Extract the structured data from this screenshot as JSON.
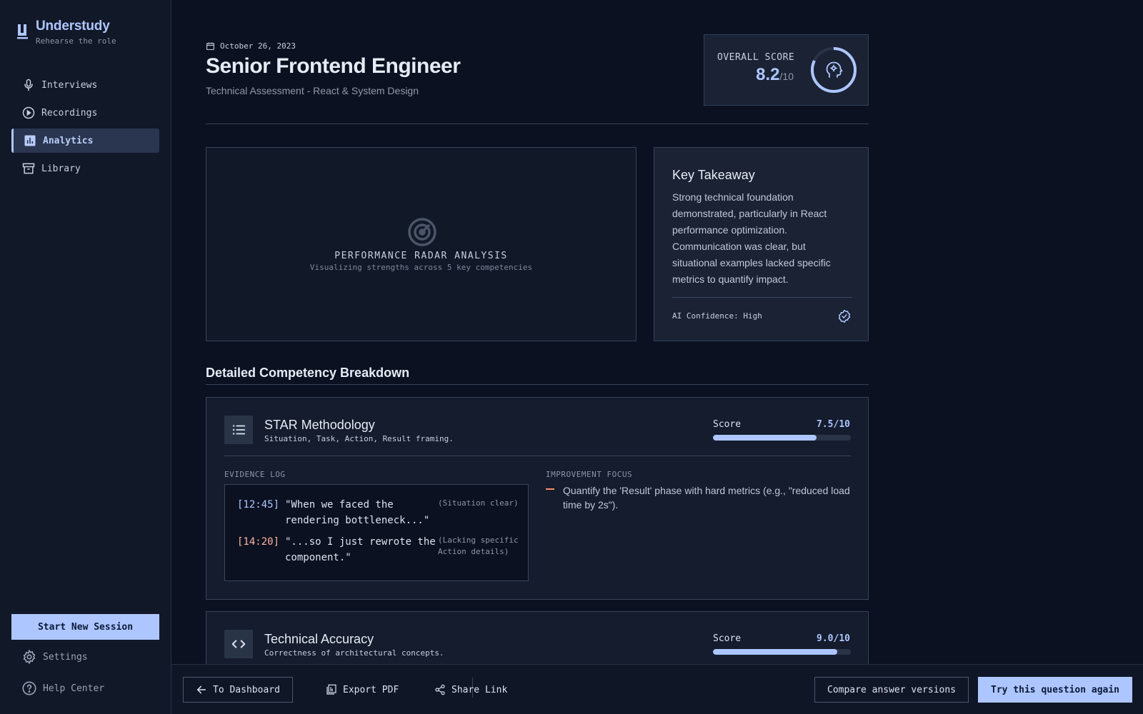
{
  "app": {
    "name": "Understudy",
    "tagline": "Rehearse the role"
  },
  "nav": {
    "items": [
      {
        "label": "Interviews",
        "icon": "microphone-icon",
        "active": false
      },
      {
        "label": "Recordings",
        "icon": "play-circle-icon",
        "active": false
      },
      {
        "label": "Analytics",
        "icon": "bar-chart-icon",
        "active": true
      },
      {
        "label": "Library",
        "icon": "archive-icon",
        "active": false
      }
    ],
    "start_session": "Start New Session",
    "settings": "Settings",
    "help": "Help Center"
  },
  "header": {
    "date": "October 26, 2023",
    "title": "Senior Frontend Engineer",
    "subtitle": "Technical Assessment - React & System Design",
    "score_label": "OVERALL SCORE",
    "score_value": "8.2",
    "score_max": "/10",
    "score_fraction": 0.82
  },
  "radar": {
    "title": "PERFORMANCE RADAR ANALYSIS",
    "subtitle": "Visualizing strengths across 5 key competencies"
  },
  "takeaway": {
    "title": "Key Takeaway",
    "body": "Strong technical foundation demonstrated, particularly in React performance optimization. Communication was clear, but situational examples lacked specific metrics to quantify impact.",
    "confidence": "AI Confidence: High"
  },
  "breakdown": {
    "title": "Detailed Competency Breakdown",
    "score_label": "Score",
    "competencies": [
      {
        "title": "STAR Methodology",
        "desc": "Situation, Task, Action, Result framing.",
        "score": "7.5/10",
        "fraction": 0.75,
        "icon": "list-icon",
        "evidence_label": "EVIDENCE LOG",
        "evidence": [
          {
            "ts": "[12:45]",
            "quote": "\"When we faced the rendering bottleneck...\"",
            "note": "(Situation clear)",
            "color": "#aec6ff"
          },
          {
            "ts": "[14:20]",
            "quote": "\"...so I just rewrote the component.\"",
            "note": "(Lacking specific Action details)",
            "color": "#ffb4a1"
          }
        ],
        "improvement_label": "IMPROVEMENT FOCUS",
        "improvement": "Quantify the 'Result' phase with hard metrics (e.g., \"reduced load time by 2s\")."
      },
      {
        "title": "Technical Accuracy",
        "desc": "Correctness of architectural concepts.",
        "score": "9.0/10",
        "fraction": 0.9,
        "icon": "code-icon"
      }
    ]
  },
  "bottom": {
    "dashboard": "To Dashboard",
    "export": "Export PDF",
    "share": "Share Link",
    "compare": "Compare answer versions",
    "retry": "Try this question again"
  },
  "colors": {
    "accent": "#aec6ff",
    "warning": "#ff8a65",
    "background": "#0b1120"
  }
}
